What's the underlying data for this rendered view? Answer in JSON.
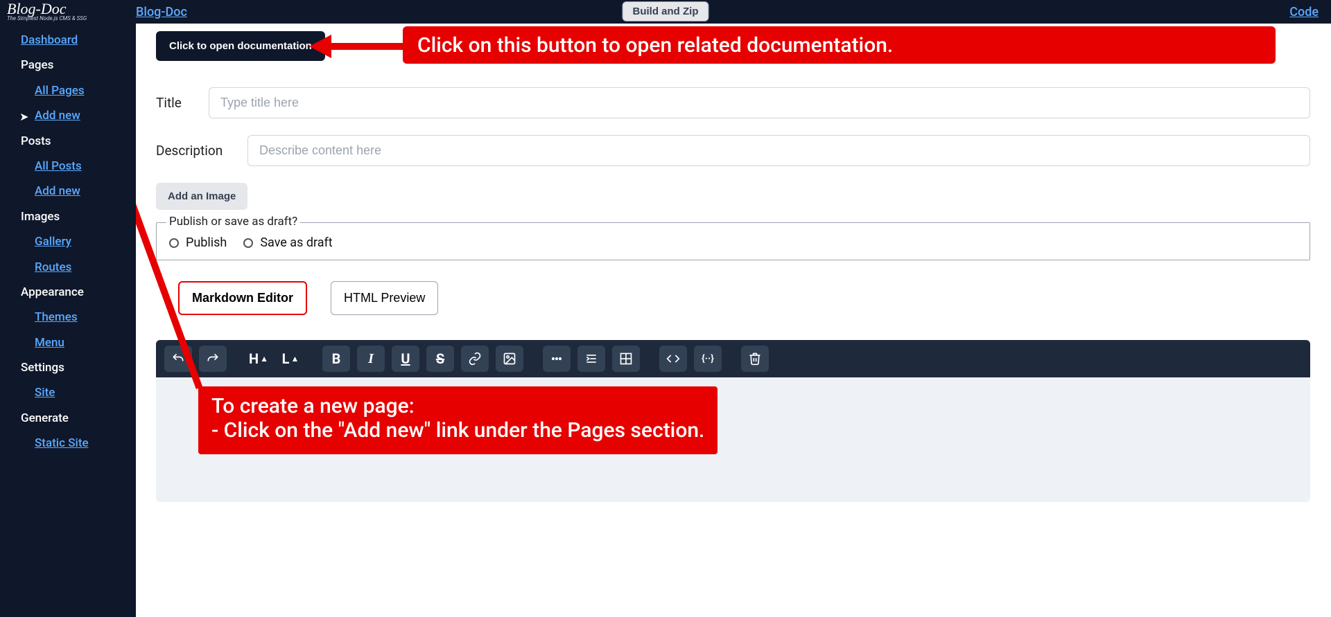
{
  "brand": {
    "title": "Blog-Doc",
    "subtitle": "The Simplest Node.js CMS & SSG"
  },
  "topbar": {
    "left_link": "Blog-Doc",
    "build_button": "Build and Zip",
    "right_link": "Code"
  },
  "sidebar": {
    "dashboard": "Dashboard",
    "pages_head": "Pages",
    "pages": {
      "all": "All Pages",
      "add": "Add new"
    },
    "posts_head": "Posts",
    "posts": {
      "all": "All Posts",
      "add": "Add new"
    },
    "images_head": "Images",
    "images": {
      "gallery": "Gallery",
      "routes": "Routes"
    },
    "appearance_head": "Appearance",
    "appearance": {
      "themes": "Themes",
      "menu": "Menu"
    },
    "settings_head": "Settings",
    "settings": {
      "site": "Site"
    },
    "generate_head": "Generate",
    "generate": {
      "static": "Static Site"
    }
  },
  "doc_button": "Click to open documentation",
  "callouts": {
    "top": "Click on this button to open related documentation.",
    "bottom": "To create a new page:\n- Click on the \"Add new\" link under the Pages section."
  },
  "form": {
    "title_label": "Title",
    "title_placeholder": "Type title here",
    "desc_label": "Description",
    "desc_placeholder": "Describe content here",
    "add_image": "Add an Image",
    "fieldset_legend": "Publish or save as draft?",
    "radio_publish": "Publish",
    "radio_draft": "Save as draft"
  },
  "tabs": {
    "markdown": "Markdown Editor",
    "html": "HTML Preview"
  },
  "toolbar_icons": {
    "undo": "undo",
    "redo": "redo",
    "heading": "H",
    "line": "L",
    "bold": "B",
    "italic": "I",
    "underline": "U",
    "strike": "S",
    "link": "link",
    "image": "image",
    "more": "more",
    "indent": "indent",
    "table": "table",
    "code": "code",
    "braces": "braces",
    "trash": "trash"
  }
}
